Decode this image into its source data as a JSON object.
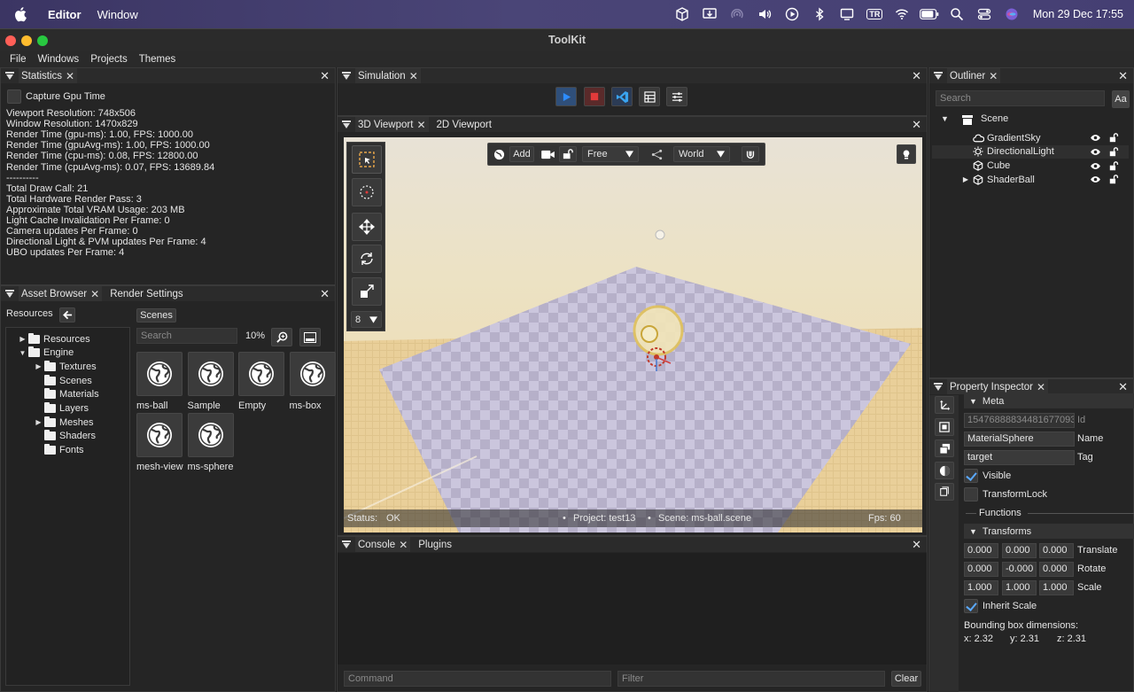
{
  "menubar": {
    "app": "Editor",
    "items": [
      "Window"
    ],
    "clock": "Mon 29 Dec  17:55",
    "tr": "TR"
  },
  "window": {
    "title": "ToolKit"
  },
  "appmenu": [
    "File",
    "Windows",
    "Projects",
    "Themes"
  ],
  "statistics": {
    "tab": "Statistics",
    "capture_label": "Capture Gpu Time",
    "lines": [
      "Viewport Resolution: 748x506",
      "Window Resolution: 1470x829",
      "Render Time (gpu-ms): 1.00, FPS: 1000.00",
      "Render Time (gpuAvg-ms): 1.00, FPS: 1000.00",
      "Render Time (cpu-ms): 0.08, FPS: 12800.00",
      "Render Time (cpuAvg-ms): 0.07, FPS: 13689.84",
      "----------",
      "Total Draw Call: 21",
      "Total Hardware Render Pass: 3",
      "Approximate Total VRAM Usage: 203 MB",
      "Light Cache Invalidation Per Frame: 0",
      "Camera updates Per Frame: 0",
      "Directional Light & PVM updates Per Frame: 4",
      "UBO updates Per Frame: 4"
    ]
  },
  "asset_browser": {
    "tab": "Asset Browser",
    "tab2": "Render Settings",
    "resources_label": "Resources",
    "folder_tab": "Scenes",
    "search_placeholder": "Search",
    "zoom": "10%",
    "tree": [
      {
        "label": "Resources",
        "expand": "▶"
      },
      {
        "label": "Engine",
        "expand": "▼"
      },
      {
        "label": "Textures",
        "expand": "▶"
      },
      {
        "label": "Scenes",
        "expand": ""
      },
      {
        "label": "Materials",
        "expand": ""
      },
      {
        "label": "Layers",
        "expand": ""
      },
      {
        "label": "Meshes",
        "expand": "▶"
      },
      {
        "label": "Shaders",
        "expand": ""
      },
      {
        "label": "Fonts",
        "expand": ""
      }
    ],
    "assets": [
      "ms-ball",
      "Sample",
      "Empty",
      "ms-box",
      "mesh-view",
      "ms-sphere"
    ]
  },
  "simulation": {
    "tab": "Simulation"
  },
  "viewport": {
    "tab": "3D Viewport",
    "tab2": "2D Viewport",
    "add_label": "Add",
    "camera_mode": "Free",
    "space": "World",
    "snap": "8",
    "status_label": "Status:",
    "status_value": "OK",
    "project": "Project: test13",
    "scene": "Scene: ms-ball.scene",
    "fps": "Fps: 60"
  },
  "console": {
    "tab": "Console",
    "tab2": "Plugins",
    "command_placeholder": "Command",
    "filter_placeholder": "Filter",
    "clear_label": "Clear"
  },
  "outliner": {
    "tab": "Outliner",
    "search_placeholder": "Search",
    "case_label": "Aa",
    "root": "Scene",
    "items": [
      {
        "label": "GradientSky",
        "icon": "cloud-icon"
      },
      {
        "label": "DirectionalLight",
        "icon": "sun-icon"
      },
      {
        "label": "Cube",
        "icon": "cube-icon"
      },
      {
        "label": "ShaderBall",
        "icon": "cube-icon"
      }
    ]
  },
  "inspector": {
    "tab": "Property Inspector",
    "meta_label": "Meta",
    "id_value": "15476888834481677093",
    "id_label": "Id",
    "name_value": "MaterialSphere",
    "name_label": "Name",
    "tag_value": "target",
    "tag_label": "Tag",
    "visible_label": "Visible",
    "transformlock_label": "TransformLock",
    "functions_label": "Functions",
    "transforms_label": "Transforms",
    "translate": [
      "0.000",
      "0.000",
      "0.000"
    ],
    "translate_label": "Translate",
    "rotate": [
      "0.000",
      "-0.000",
      "0.000"
    ],
    "rotate_label": "Rotate",
    "scale": [
      "1.000",
      "1.000",
      "1.000"
    ],
    "scale_label": "Scale",
    "inherit_label": "Inherit Scale",
    "bbox_label": "Bounding box dimensions:",
    "bbox_x": "x: 2.32",
    "bbox_y": "y: 2.31",
    "bbox_z": "z: 2.31"
  }
}
